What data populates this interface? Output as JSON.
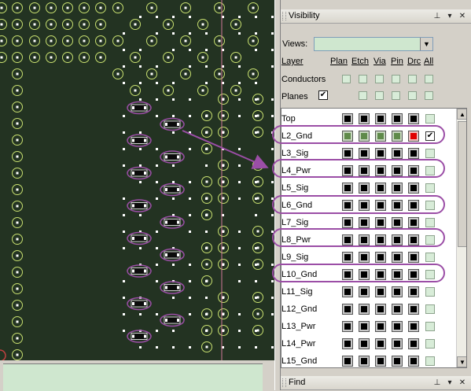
{
  "visibility_panel": {
    "title": "Visibility",
    "views_label": "Views:",
    "views_value": "",
    "headers": {
      "layer": "Layer",
      "plan": "Plan",
      "etch": "Etch",
      "via": "Via",
      "pin": "Pin",
      "drc": "Drc",
      "all": "All"
    },
    "conductors_label": "Conductors",
    "planes_label": "Planes",
    "planes_checked": true,
    "layers": [
      {
        "name": "Top",
        "swatches": [
          "black",
          "black",
          "black",
          "black",
          "black"
        ],
        "all": false
      },
      {
        "name": "L2_Gnd",
        "swatches": [
          "green",
          "green",
          "green",
          "green",
          "red"
        ],
        "all": true,
        "highlighted": true
      },
      {
        "name": "L3_Sig",
        "swatches": [
          "black",
          "black",
          "black",
          "black",
          "black"
        ],
        "all": false
      },
      {
        "name": "L4_Pwr",
        "swatches": [
          "black",
          "black",
          "black",
          "black",
          "black"
        ],
        "all": false,
        "highlighted": true
      },
      {
        "name": "L5_Sig",
        "swatches": [
          "black",
          "black",
          "black",
          "black",
          "black"
        ],
        "all": false
      },
      {
        "name": "L6_Gnd",
        "swatches": [
          "black",
          "black",
          "black",
          "black",
          "black"
        ],
        "all": false,
        "highlighted": true
      },
      {
        "name": "L7_Sig",
        "swatches": [
          "black",
          "black",
          "black",
          "black",
          "black"
        ],
        "all": false
      },
      {
        "name": "L8_Pwr",
        "swatches": [
          "black",
          "black",
          "black",
          "black",
          "black"
        ],
        "all": false,
        "highlighted": true
      },
      {
        "name": "L9_Sig",
        "swatches": [
          "black",
          "black",
          "black",
          "black",
          "black"
        ],
        "all": false
      },
      {
        "name": "L10_Gnd",
        "swatches": [
          "black",
          "black",
          "black",
          "black",
          "black"
        ],
        "all": false,
        "highlighted": true
      },
      {
        "name": "L11_Sig",
        "swatches": [
          "black",
          "black",
          "black",
          "black",
          "black"
        ],
        "all": false
      },
      {
        "name": "L12_Gnd",
        "swatches": [
          "black",
          "black",
          "black",
          "black",
          "black"
        ],
        "all": false
      },
      {
        "name": "L13_Pwr",
        "swatches": [
          "black",
          "black",
          "black",
          "black",
          "black"
        ],
        "all": false
      },
      {
        "name": "L14_Pwr",
        "swatches": [
          "black",
          "black",
          "black",
          "black",
          "black"
        ],
        "all": false
      },
      {
        "name": "L15_Gnd",
        "swatches": [
          "black",
          "black",
          "black",
          "black",
          "black"
        ],
        "all": false
      }
    ]
  },
  "find_panel": {
    "title": "Find"
  },
  "icons": {
    "pin": "pushpin-icon",
    "close": "close-icon",
    "dropdown": "chevron-down-icon"
  },
  "colors": {
    "canvas_bg": "#233322",
    "via_ring": "#c8e070",
    "pad_dot": "#ffffff",
    "highlight": "#9b4ea6",
    "board_edge": "#d27a9a",
    "swatch_green": "#5f8a4a",
    "swatch_red": "#e00000"
  }
}
